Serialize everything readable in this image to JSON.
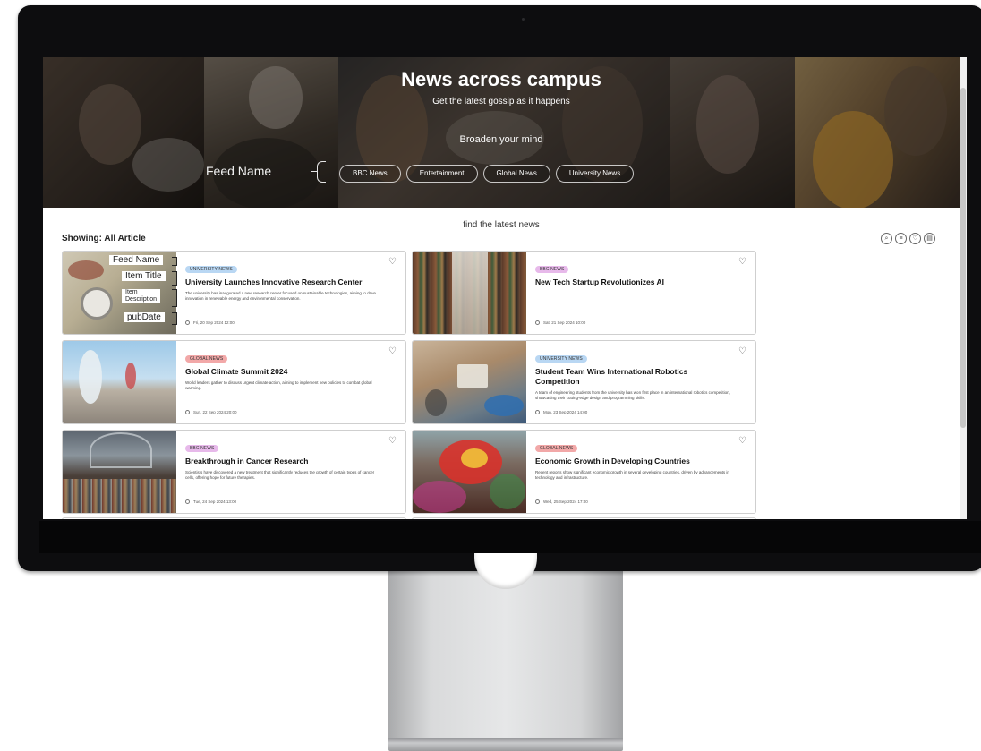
{
  "hero": {
    "title": "News across campus",
    "subtitle": "Get the latest gossip as it happens",
    "tagline": "Broaden your mind",
    "feed_label": "Feed Name",
    "feeds": [
      "BBC News",
      "Entertainment",
      "Global News",
      "University News"
    ]
  },
  "main": {
    "find_latest": "find the latest news",
    "showing": "Showing: All Article",
    "tools": [
      "search-icon",
      "list-icon",
      "heart-icon",
      "calendar-icon"
    ]
  },
  "annotations": {
    "feed_name": "Feed Name",
    "item_title": "Item Title",
    "item_description_1": "Item",
    "item_description_2": "Description",
    "pub_date": "pubDate"
  },
  "articles": [
    {
      "tag": "UNIVERSITY NEWS",
      "tag_style": "uni",
      "title": "University Launches Innovative Research Center",
      "description": "The university has inaugurated a new research center focused on sustainable technologies, aiming to drive innovation in renewable energy and environmental conservation.",
      "date": "Fri, 20 Sep 2024 12:00",
      "image": "library"
    },
    {
      "tag": "BBC NEWS",
      "tag_style": "bbc",
      "title": "New Tech Startup Revolutionizes AI",
      "description": "",
      "date": "Sat, 21 Sep 2024 10:00",
      "image": "bookshelves"
    },
    {
      "tag": "GLOBAL NEWS",
      "tag_style": "global",
      "title": "Global Climate Summit 2024",
      "description": "World leaders gather to discuss urgent climate action, aiming to implement new policies to combat global warming.",
      "date": "Sun, 22 Sep 2024 20:00",
      "image": "runners"
    },
    {
      "tag": "UNIVERSITY NEWS",
      "tag_style": "uni",
      "title": "Student Team Wins International Robotics Competition",
      "description": "A team of engineering students from the university has won first place in an international robotics competition, showcasing their cutting-edge design and programming skills.",
      "date": "Mon, 23 Sep 2024 14:00",
      "image": "office"
    },
    {
      "tag": "BBC NEWS",
      "tag_style": "bbc",
      "title": "Breakthrough in Cancer Research",
      "description": "Scientists have discovered a new treatment that significantly reduces the growth of certain types of cancer cells, offering hope for future therapies.",
      "date": "Tue, 24 Sep 2024 13:00",
      "image": "market"
    },
    {
      "tag": "GLOBAL NEWS",
      "tag_style": "global",
      "title": "Economic Growth in Developing Countries",
      "description": "Recent reports show significant economic growth in several developing countries, driven by advancements in technology and infrastructure.",
      "date": "Wed, 25 Sep 2024 17:00",
      "image": "dragon"
    }
  ]
}
